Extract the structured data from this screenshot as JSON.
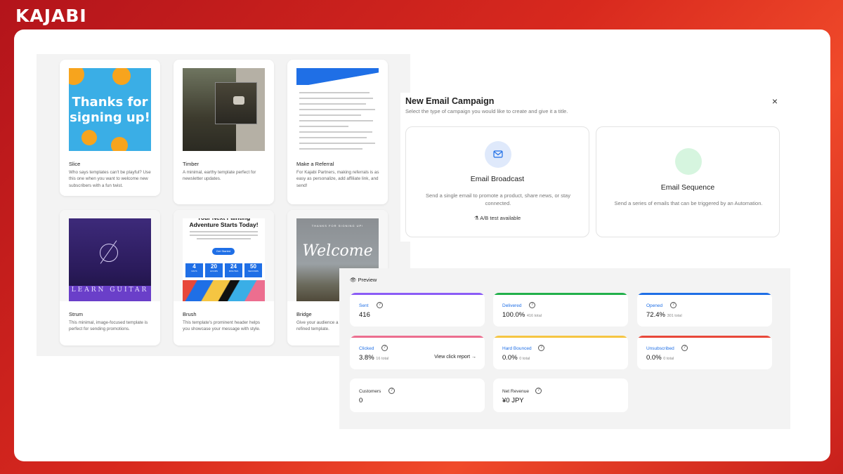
{
  "brand": "KAJABI",
  "templates": [
    {
      "name": "Slice",
      "desc": "Who says templates can't be playful? Use this one when you want to welcome new subscribers with a fun twist.",
      "thumb_text": "Thanks for signing up!"
    },
    {
      "name": "Timber",
      "desc": "A minimal, earthy template perfect for newsletter updates."
    },
    {
      "name": "Make a Referral",
      "desc": "For Kajabi Partners, making referrals is as easy as personalize, add affiliate link, and send!"
    },
    {
      "name": "Strum",
      "desc": "This minimal, image-focused template is perfect for sending promotions.",
      "thumb_text": "LEARN GUITAR"
    },
    {
      "name": "Brush",
      "desc": "This template's prominent header helps you showcase your message with style.",
      "thumb_heading": "Your Next Painting Adventure Starts Today!",
      "thumb_button": "Get Started",
      "countdown": [
        {
          "num": "4",
          "unit": "DAYS"
        },
        {
          "num": "20",
          "unit": "HOURS"
        },
        {
          "num": "24",
          "unit": "MINUTES"
        },
        {
          "num": "50",
          "unit": "SECONDS"
        }
      ]
    },
    {
      "name": "Bridge",
      "desc": "Give your audience a c... this simple yet refined template.",
      "thumb_text": "Welcome",
      "thumb_small": "THANKS FOR SIGNING UP!"
    }
  ],
  "modal": {
    "title": "New Email Campaign",
    "subtitle": "Select the type of campaign you would like to create and give it a title.",
    "close": "×",
    "options": [
      {
        "title": "Email Broadcast",
        "desc": "Send a single email to promote a product, share news, or stay connected.",
        "extra": "A/B test available",
        "icon": "envelope-icon",
        "color": "#dfe9fb"
      },
      {
        "title": "Email Sequence",
        "desc": "Send a series of emails that can be triggered by an Automation.",
        "icon": "sequence-icon",
        "color": "#d6f5df"
      }
    ]
  },
  "stats": {
    "preview_label": "Preview",
    "items": [
      {
        "label": "Sent",
        "value": "416",
        "sub": "",
        "color": "#8b5cf6"
      },
      {
        "label": "Delivered",
        "value": "100.0%",
        "sub": "416 total",
        "color": "#22b04b"
      },
      {
        "label": "Opened",
        "value": "72.4%",
        "sub": "301 total",
        "color": "#1f6fe6"
      },
      {
        "label": "Clicked",
        "value": "3.8%",
        "sub": "16 total",
        "color": "#ec6e8f",
        "link": "View click report →"
      },
      {
        "label": "Hard Bounced",
        "value": "0.0%",
        "sub": "0 total",
        "color": "#f5c542"
      },
      {
        "label": "Unsubscribed",
        "value": "0.0%",
        "sub": "0 total",
        "color": "#e8483a"
      },
      {
        "label": "Customers",
        "value": "0",
        "sub": ""
      },
      {
        "label": "Net Revenue",
        "value": "¥0 JPY",
        "sub": ""
      }
    ]
  }
}
